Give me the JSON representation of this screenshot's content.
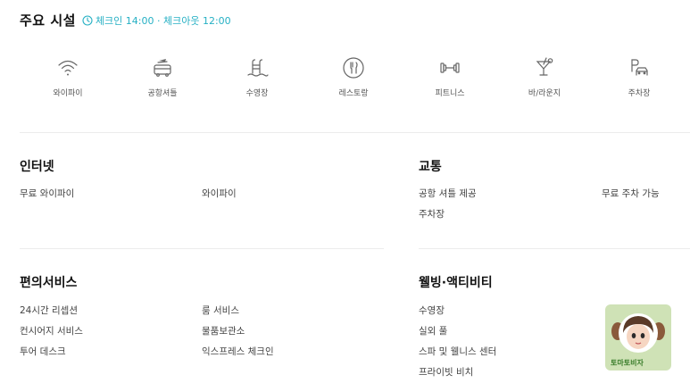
{
  "header": {
    "title": "주요 시설",
    "checkin": "체크인 14:00 · 체크아웃 12:00"
  },
  "amenities": [
    {
      "label": "와이파이",
      "icon": "wifi-icon"
    },
    {
      "label": "공항셔틀",
      "icon": "shuttle-icon"
    },
    {
      "label": "수영장",
      "icon": "pool-icon"
    },
    {
      "label": "레스토랑",
      "icon": "restaurant-icon"
    },
    {
      "label": "피트니스",
      "icon": "dumbbell-icon"
    },
    {
      "label": "바/라운지",
      "icon": "cocktail-icon"
    },
    {
      "label": "주차장",
      "icon": "parking-icon"
    }
  ],
  "sections": {
    "internet": {
      "title": "인터넷",
      "items": [
        "무료 와이파이",
        "와이파이"
      ]
    },
    "transport": {
      "title": "교통",
      "items": [
        "공항 셔틀 제공",
        "무료 주차 가능",
        "주차장"
      ]
    },
    "services": {
      "title": "편의서비스",
      "items": [
        "24시간 리셉션",
        "룸 서비스",
        "컨시어지 서비스",
        "물품보관소",
        "투어 데스크",
        "익스프레스 체크인"
      ]
    },
    "wellness": {
      "title": "웰빙·액티비티",
      "items": [
        "수영장",
        "실외 풀",
        "스파 및 웰니스 센터",
        "프라이빗 비치"
      ]
    }
  },
  "badge": {
    "text": "토마토비자"
  },
  "colors": {
    "accent": "#26b0c4",
    "icon": "#666666",
    "divider": "#ececec"
  }
}
